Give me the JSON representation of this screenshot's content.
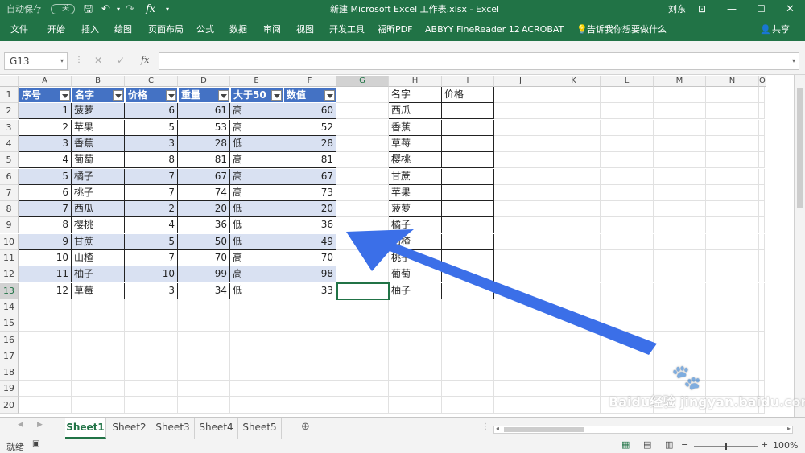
{
  "titlebar": {
    "autosave_label": "自动保存",
    "autosave_state": "关",
    "title": "新建 Microsoft Excel 工作表.xlsx  -  Excel",
    "user": "刘东"
  },
  "ribbon": {
    "tabs": [
      "文件",
      "开始",
      "插入",
      "绘图",
      "页面布局",
      "公式",
      "数据",
      "审阅",
      "视图",
      "开发工具",
      "福昕PDF",
      "ABBYY FineReader 12",
      "ACROBAT"
    ],
    "tellme": "告诉我你想要做什么",
    "share": "共享"
  },
  "formula": {
    "namebox": "G13",
    "content": ""
  },
  "grid": {
    "columns": [
      "A",
      "B",
      "C",
      "D",
      "E",
      "F",
      "G",
      "H",
      "I",
      "J",
      "K",
      "L",
      "M",
      "N",
      "O"
    ],
    "rows": [
      "1",
      "2",
      "3",
      "4",
      "5",
      "6",
      "7",
      "8",
      "9",
      "10",
      "11",
      "12",
      "13",
      "14",
      "15",
      "16",
      "17",
      "18",
      "19",
      "20"
    ],
    "table_headers": [
      "序号",
      "名字",
      "价格",
      "重量",
      "大于50",
      "数值"
    ],
    "table_rows": [
      [
        "1",
        "菠萝",
        "6",
        "61",
        "高",
        "60"
      ],
      [
        "2",
        "苹果",
        "5",
        "53",
        "高",
        "52"
      ],
      [
        "3",
        "香蕉",
        "3",
        "28",
        "低",
        "28"
      ],
      [
        "4",
        "葡萄",
        "8",
        "81",
        "高",
        "81"
      ],
      [
        "5",
        "橘子",
        "7",
        "67",
        "高",
        "67"
      ],
      [
        "6",
        "桃子",
        "7",
        "74",
        "高",
        "73"
      ],
      [
        "7",
        "西瓜",
        "2",
        "20",
        "低",
        "20"
      ],
      [
        "8",
        "樱桃",
        "4",
        "36",
        "低",
        "36"
      ],
      [
        "9",
        "甘蔗",
        "5",
        "50",
        "低",
        "49"
      ],
      [
        "10",
        "山楂",
        "7",
        "70",
        "高",
        "70"
      ],
      [
        "11",
        "柚子",
        "10",
        "99",
        "高",
        "98"
      ],
      [
        "12",
        "草莓",
        "3",
        "34",
        "低",
        "33"
      ]
    ],
    "lookup_headers": [
      "名字",
      "价格"
    ],
    "lookup_names": [
      "西瓜",
      "香蕉",
      "草莓",
      "樱桃",
      "甘蔗",
      "苹果",
      "菠萝",
      "橘子",
      "山楂",
      "桃子",
      "葡萄",
      "柚子"
    ]
  },
  "sheets": [
    "Sheet1",
    "Sheet2",
    "Sheet3",
    "Sheet4",
    "Sheet5"
  ],
  "active_sheet": "Sheet1",
  "status": {
    "ready": "就绪",
    "zoom": "100%"
  },
  "watermark": "Baidu经验 jingyan.baidu.com",
  "colors": {
    "excel_green": "#217346",
    "table_header": "#4472c4",
    "table_band": "#d9e1f2",
    "arrow": "#3b6fe8"
  }
}
